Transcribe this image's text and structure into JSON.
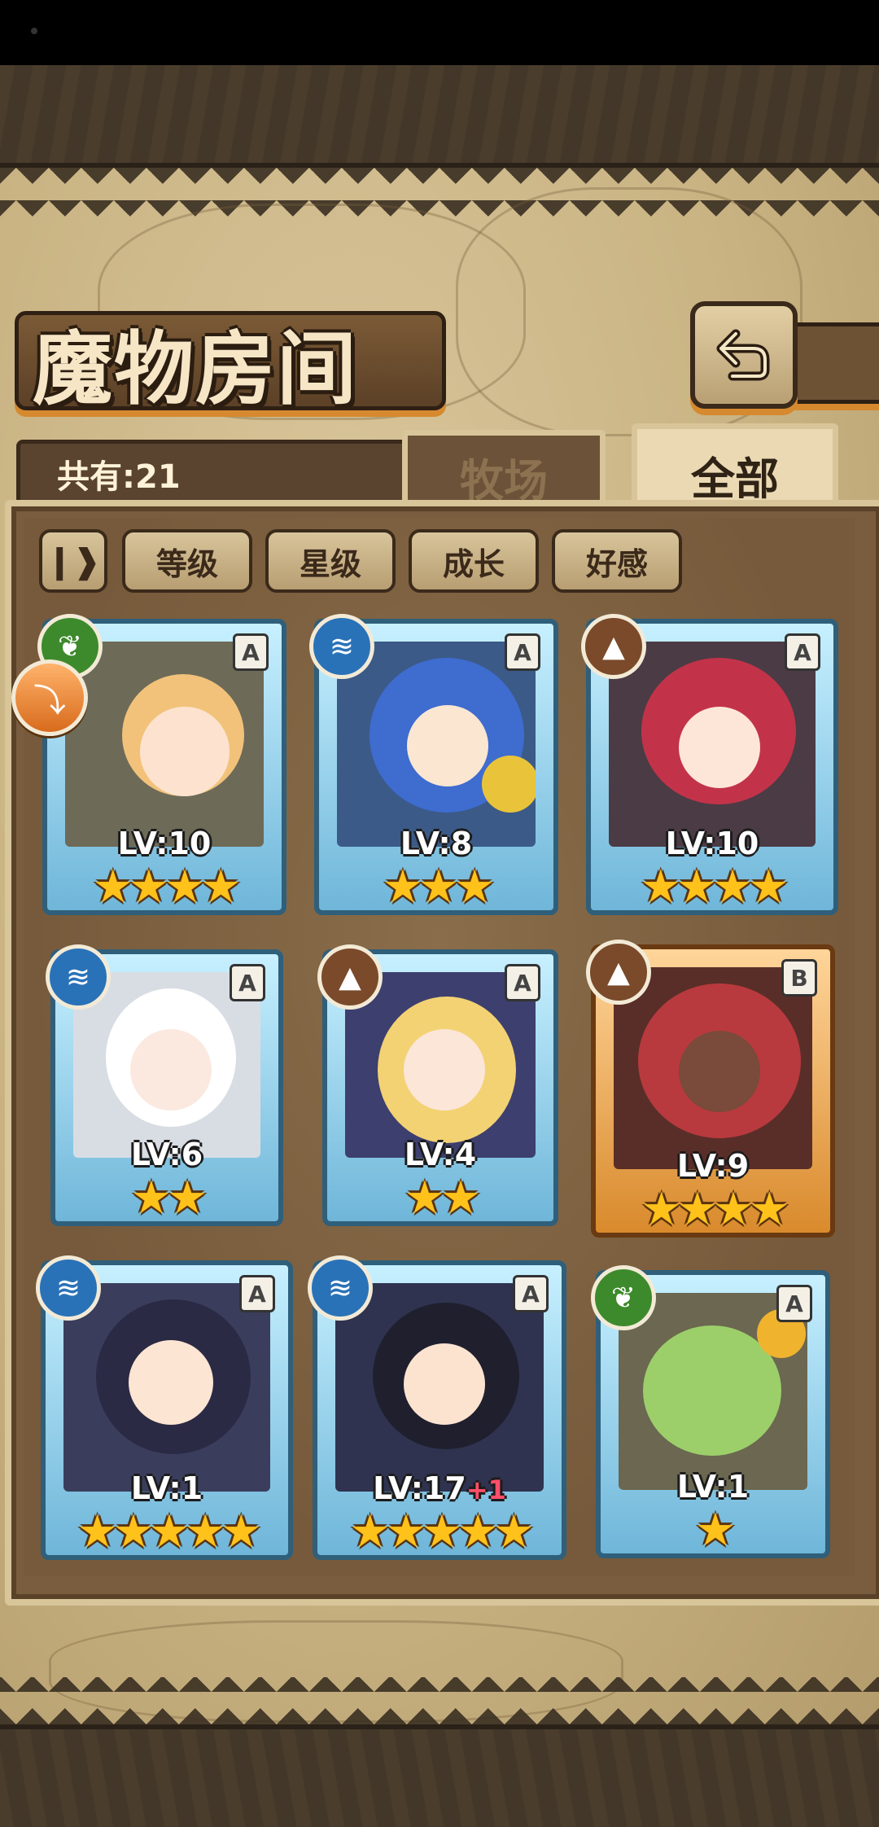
{
  "title": "魔物房间",
  "count_label": "共有:21",
  "tabs": [
    {
      "label": "牧场",
      "active": false
    },
    {
      "label": "全部",
      "active": true
    }
  ],
  "filters": {
    "sort_toggle_icon": "sort-toggle-icon",
    "items": [
      "等级",
      "星级",
      "成长",
      "好感"
    ]
  },
  "back_button_icon": "back-arrow-icon",
  "monsters": [
    {
      "level": "LV:10",
      "plus": "",
      "stars": "★★★★",
      "rank": "A",
      "element": "grass",
      "frame": "blue"
    },
    {
      "level": "LV:8",
      "plus": "",
      "stars": "★★★",
      "rank": "A",
      "element": "water",
      "frame": "blue"
    },
    {
      "level": "LV:10",
      "plus": "",
      "stars": "★★★★",
      "rank": "A",
      "element": "earth",
      "frame": "blue"
    },
    {
      "level": "LV:6",
      "plus": "",
      "stars": "★★",
      "rank": "A",
      "element": "water",
      "frame": "blue"
    },
    {
      "level": "LV:4",
      "plus": "",
      "stars": "★★",
      "rank": "A",
      "element": "earth",
      "frame": "blue"
    },
    {
      "level": "LV:9",
      "plus": "",
      "stars": "★★★★",
      "rank": "B",
      "element": "earth",
      "frame": "orange"
    },
    {
      "level": "LV:1",
      "plus": "",
      "stars": "★★★★★",
      "rank": "A",
      "element": "water",
      "frame": "blue"
    },
    {
      "level": "LV:17",
      "plus": "+1",
      "stars": "★★★★★",
      "rank": "A",
      "element": "water",
      "frame": "blue"
    },
    {
      "level": "LV:1",
      "plus": "",
      "stars": "★",
      "rank": "A",
      "element": "grass",
      "frame": "blue"
    }
  ],
  "colors": {
    "grass": "#3d8a2c",
    "water": "#2a72b8",
    "earth": "#7a4a2a",
    "star": "#ffc21a"
  }
}
